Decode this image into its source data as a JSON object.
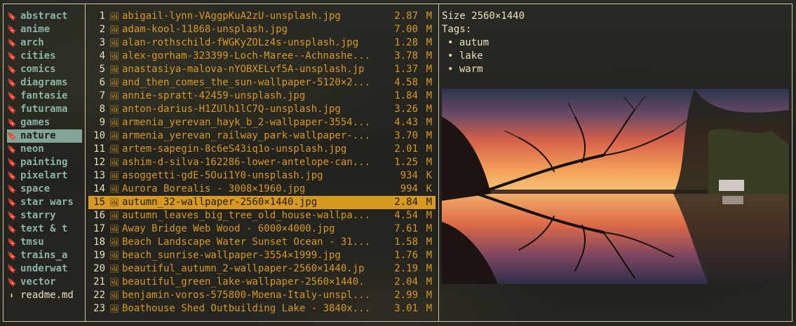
{
  "directories": [
    {
      "name": "abstract",
      "selected": false
    },
    {
      "name": "anime",
      "selected": false
    },
    {
      "name": "arch",
      "selected": false
    },
    {
      "name": "cities",
      "selected": false
    },
    {
      "name": "comics",
      "selected": false
    },
    {
      "name": "diagrams",
      "selected": false
    },
    {
      "name": "fantasie",
      "selected": false
    },
    {
      "name": "futurama",
      "selected": false
    },
    {
      "name": "games",
      "selected": false
    },
    {
      "name": "nature",
      "selected": true
    },
    {
      "name": "neon",
      "selected": false
    },
    {
      "name": "painting",
      "selected": false
    },
    {
      "name": "pixelart",
      "selected": false
    },
    {
      "name": "space",
      "selected": false
    },
    {
      "name": "star wars",
      "selected": false
    },
    {
      "name": "starry",
      "selected": false
    },
    {
      "name": "text & t",
      "selected": false
    },
    {
      "name": "tmsu",
      "selected": false
    },
    {
      "name": "trains_a",
      "selected": false
    },
    {
      "name": "underwat",
      "selected": false
    },
    {
      "name": "vector",
      "selected": false
    }
  ],
  "readme": {
    "name": "readme.md",
    "icon": "⬇"
  },
  "folder_icon": "🔖",
  "file_icon": "🖼",
  "files": [
    {
      "num": "1",
      "name": "abigail-lynn-VAggpKuA2zU-unsplash.jpg",
      "size": "2.87",
      "unit": "M",
      "selected": false
    },
    {
      "num": "2",
      "name": "adam-kool-11868-unsplash.jpg",
      "size": "7.00",
      "unit": "M",
      "selected": false
    },
    {
      "num": "3",
      "name": "alan-rothschild-fWGKyZOLz4s-unsplash.jpg",
      "size": "1.28",
      "unit": "M",
      "selected": false
    },
    {
      "num": "4",
      "name": "alex-gorham-323399-Loch-Maree--Achnashe...",
      "size": "3.78",
      "unit": "M",
      "selected": false
    },
    {
      "num": "5",
      "name": "anastasiya-malova-nYOBXELvf5A-unsplash.jp",
      "size": "1.37",
      "unit": "M",
      "selected": false
    },
    {
      "num": "6",
      "name": "and_then_comes_the_sun-wallpaper-5120×2...",
      "size": "4.58",
      "unit": "M",
      "selected": false
    },
    {
      "num": "7",
      "name": "annie-spratt-42459-unsplash.jpg",
      "size": "1.84",
      "unit": "M",
      "selected": false
    },
    {
      "num": "8",
      "name": "anton-darius-H1ZUlh1lC7Q-unsplash.jpg",
      "size": "3.26",
      "unit": "M",
      "selected": false
    },
    {
      "num": "9",
      "name": "armenia_yerevan_hayk_b_2-wallpaper-3554...",
      "size": "4.43",
      "unit": "M",
      "selected": false
    },
    {
      "num": "10",
      "name": "armenia_yerevan_railway_park-wallpaper-...",
      "size": "3.70",
      "unit": "M",
      "selected": false
    },
    {
      "num": "11",
      "name": "artem-sapegin-8c6eS43iq1o-unsplash.jpg",
      "size": "2.01",
      "unit": "M",
      "selected": false
    },
    {
      "num": "12",
      "name": "ashim-d-silva-162286-lower-antelope-can...",
      "size": "1.25",
      "unit": "M",
      "selected": false
    },
    {
      "num": "13",
      "name": "asoggetti-gdE-5Oui1Y0-unsplash.jpg",
      "size": "934",
      "unit": "K",
      "selected": false
    },
    {
      "num": "14",
      "name": "Aurora Borealis - 3008×1960.jpg",
      "size": "994",
      "unit": "K",
      "selected": false
    },
    {
      "num": "15",
      "name": "autumn_32-wallpaper-2560×1440.jpg",
      "size": "2.84",
      "unit": "M",
      "selected": true
    },
    {
      "num": "16",
      "name": "autumn_leaves_big_tree_old_house-wallpa...",
      "size": "4.54",
      "unit": "M",
      "selected": false
    },
    {
      "num": "17",
      "name": "Away Bridge Web Wood - 6000×4000.jpg",
      "size": "7.61",
      "unit": "M",
      "selected": false
    },
    {
      "num": "18",
      "name": "Beach Landscape Water Sunset Ocean - 31...",
      "size": "1.58",
      "unit": "M",
      "selected": false
    },
    {
      "num": "19",
      "name": "beach_sunrise-wallpaper-3554×1999.jpg",
      "size": "1.76",
      "unit": "M",
      "selected": false
    },
    {
      "num": "20",
      "name": "beautiful_autumn_2-wallpaper-2560×1440.jp",
      "size": "2.19",
      "unit": "M",
      "selected": false
    },
    {
      "num": "21",
      "name": "beautiful_green_lake-wallpaper-2560×1440.",
      "size": "2.04",
      "unit": "M",
      "selected": false
    },
    {
      "num": "22",
      "name": "benjamin-voros-575800-Moena-Italy-unspl...",
      "size": "2.99",
      "unit": "M",
      "selected": false
    },
    {
      "num": "23",
      "name": "Boathouse Shed Outbuilding Lake - 3840x...",
      "size": "3.01",
      "unit": "M",
      "selected": false
    }
  ],
  "preview": {
    "size_text": "Size 2560×1440",
    "tags_label": "Tags:",
    "tags": [
      "autum",
      "lake",
      "warm"
    ],
    "bullet": "•"
  }
}
